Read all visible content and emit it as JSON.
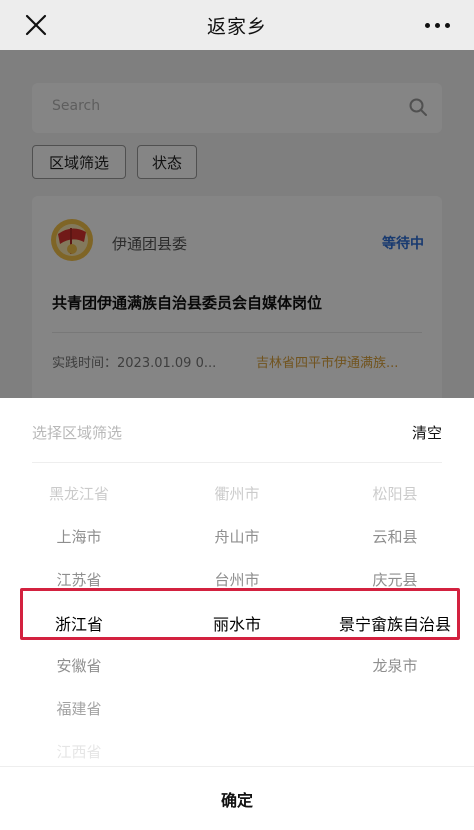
{
  "header": {
    "title": "返家乡"
  },
  "search": {
    "placeholder": "Search"
  },
  "filters": {
    "region_label": "区域筛选",
    "status_label": "状态"
  },
  "card": {
    "org": "伊通团县委",
    "status": "等待中",
    "title": "共青团伊通满族自治县委员会自媒体岗位",
    "time": "实践时间：2023.01.09 0...",
    "location": "吉林省四平市伊通满族..."
  },
  "sheet": {
    "title": "选择区域筛选",
    "clear_label": "清空",
    "confirm_label": "确定",
    "province": [
      "黑龙江省",
      "上海市",
      "江苏省",
      "浙江省",
      "安徽省",
      "福建省",
      "江西省"
    ],
    "city": [
      "衢州市",
      "舟山市",
      "台州市",
      "丽水市"
    ],
    "county": [
      "松阳县",
      "云和县",
      "庆元县",
      "景宁畲族自治县",
      "龙泉市"
    ]
  }
}
